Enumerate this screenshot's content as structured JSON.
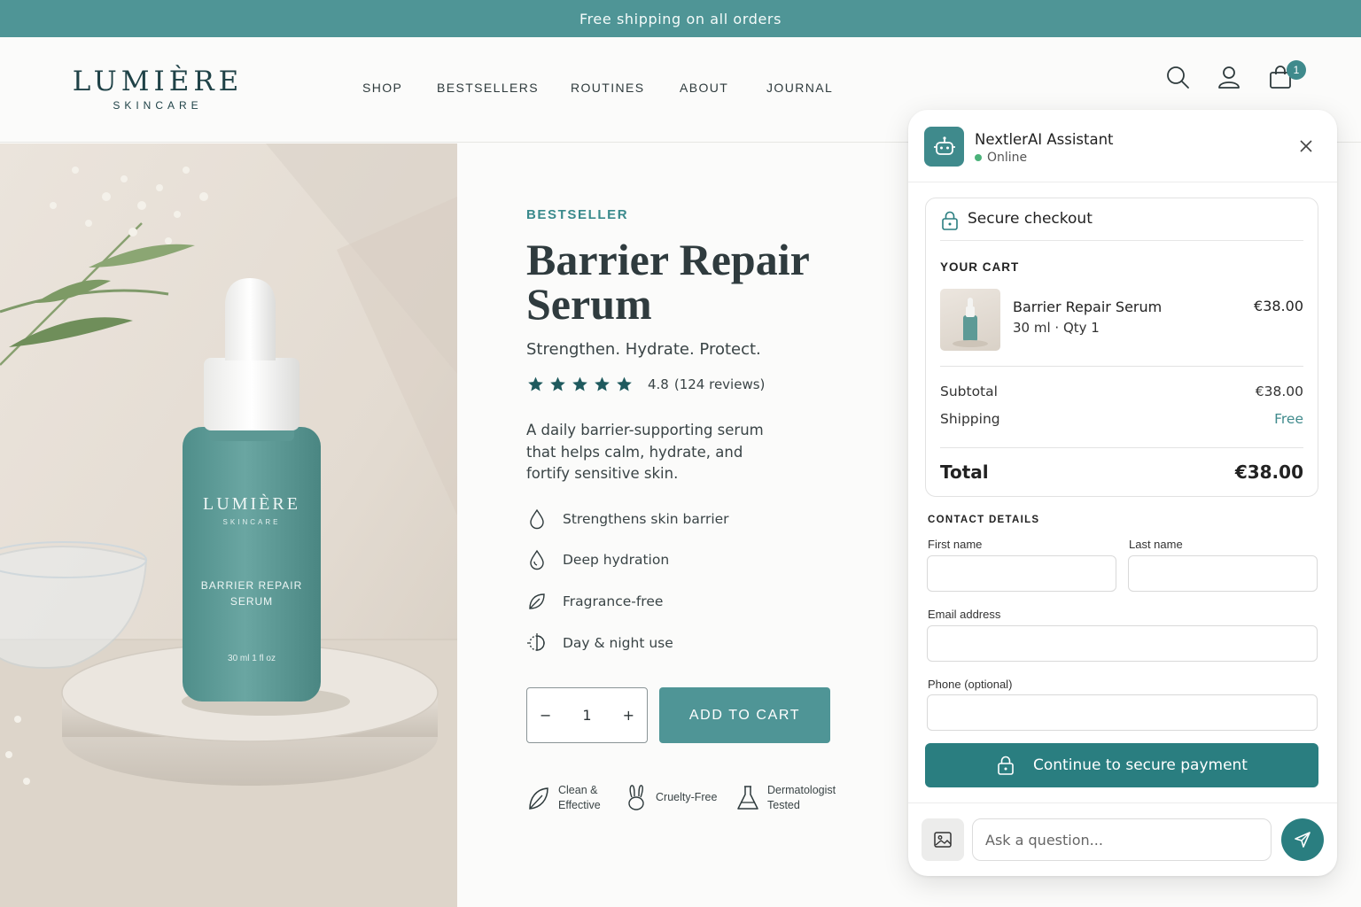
{
  "announcement": "Free shipping on all orders",
  "brand": {
    "name": "LUMIÈRE",
    "sub": "SKINCARE"
  },
  "nav": [
    "SHOP",
    "BESTSELLERS",
    "ROUTINES",
    "ABOUT",
    "JOURNAL"
  ],
  "header": {
    "cart_count": "1"
  },
  "product": {
    "kicker": "BESTSELLER",
    "title": "Barrier Repair Serum",
    "tagline": "Strengthen. Hydrate. Protect.",
    "rating": "4.8",
    "reviews": "(124 reviews)",
    "stars": 5,
    "description": "A daily barrier-supporting serum that helps calm, hydrate, and fortify sensitive skin.",
    "features": [
      "Strengthens skin barrier",
      "Deep hydration",
      "Fragrance-free",
      "Day & night use"
    ],
    "quantity": "1",
    "add_to_cart": "ADD TO CART",
    "trust": [
      "Clean & Effective",
      "Cruelty-Free",
      "Dermatologist Tested"
    ]
  },
  "bottle_label": {
    "brand": "LUMIÈRE",
    "sub": "SKINCARE",
    "line1": "BARRIER REPAIR",
    "line2": "SERUM",
    "size": "30 ml 1 fl oz"
  },
  "chat": {
    "assistant_name": "NextlerAI Assistant",
    "status": "Online",
    "secure_title": "Secure checkout",
    "cart_label": "YOUR CART",
    "item": {
      "name": "Barrier Repair Serum",
      "meta": "30 ml · Qty 1",
      "price": "€38.00"
    },
    "subtotal_label": "Subtotal",
    "subtotal": "€38.00",
    "shipping_label": "Shipping",
    "shipping": "Free",
    "total_label": "Total",
    "total": "€38.00",
    "contact_heading": "CONTACT DETAILS",
    "fields": {
      "first_name": "First name",
      "last_name": "Last name",
      "email": "Email address",
      "phone": "Phone (optional)"
    },
    "pay_button": "Continue to secure payment",
    "input_placeholder": "Ask a question..."
  },
  "colors": {
    "teal": "#4f9596",
    "teal_dark": "#2a7e80",
    "status_green": "#4bb27a"
  }
}
